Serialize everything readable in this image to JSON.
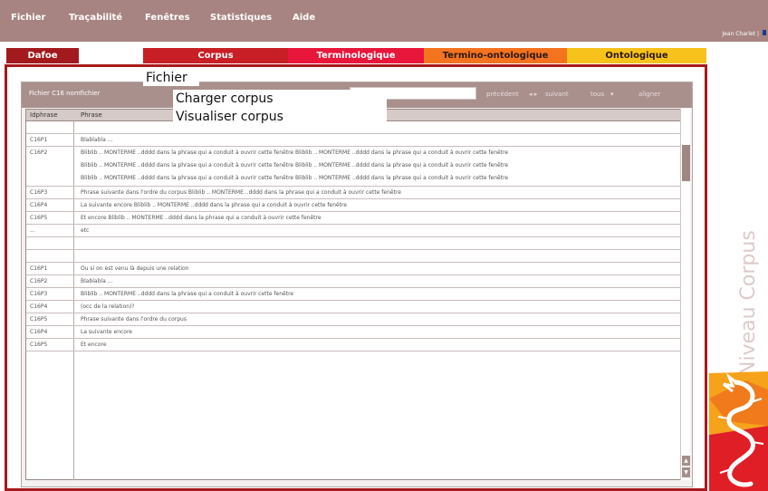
{
  "menu": [
    "Fichier",
    "Traçabilité",
    "Fenêtres",
    "Statistiques",
    "Aide"
  ],
  "user": "Jean Charlet |",
  "tabs": [
    {
      "label": "Dafoe",
      "bg": "#a21a1d",
      "color": "#ffffff"
    },
    {
      "label": "Corpus",
      "bg": "#c81e25",
      "color": "#ffffff"
    },
    {
      "label": "Terminologique",
      "bg": "#e8163a",
      "color": "#ffffff"
    },
    {
      "label": "Termino-ontologique",
      "bg": "#f4731f",
      "color": "#2a1a12"
    },
    {
      "label": "Ontologique",
      "bg": "#f7c21b",
      "color": "#2a1a12"
    }
  ],
  "panel": {
    "file_label": "Fichier C16 nomfichier",
    "precedent": "précédent",
    "suivant": "suivant",
    "tous": "tous",
    "aligner": "aligner"
  },
  "columns": [
    "Idphrase",
    "Phrase"
  ],
  "rows": [
    {
      "id": "",
      "lines": [
        ""
      ]
    },
    {
      "id": "C16P1",
      "lines": [
        "Blablabla ..."
      ]
    },
    {
      "id": "C16P2",
      "lines": [
        "Bliblib .. MONTERME ..dddd dans la phrase qui a conduit à ouvrir cette fenêtre Bliblib .. MONTERME ..dddd dans la phrase qui a conduit à ouvrir cette fenêtre",
        "Bliblib .. MONTERME ..dddd dans la phrase qui a conduit à ouvrir cette fenêtre Bliblib .. MONTERME ..dddd dans la phrase qui a conduit à ouvrir cette fenêtre",
        "Bliblib .. MONTERME ..dddd dans la phrase qui a conduit à ouvrir cette fenêtre Bliblib .. MONTERME ..dddd dans la phrase qui a conduit à ouvrir cette fenêtre"
      ]
    },
    {
      "id": "C16P3",
      "lines": [
        "Phrase suivante dans l'ordre du corpus Bliblib .. MONTERME ..dddd dans la phrase qui a conduit à ouvrir cette fenêtre"
      ]
    },
    {
      "id": "C16P4",
      "lines": [
        "La suivante encore Bliblib .. MONTERME ..dddd dans la phrase qui a conduit à ouvrir cette fenêtre"
      ]
    },
    {
      "id": "C16P5",
      "lines": [
        "Et encore Bliblib .. MONTERME ..dddd dans la phrase qui a conduit à ouvrir cette fenêtre"
      ]
    },
    {
      "id": "...",
      "lines": [
        "etc"
      ]
    },
    {
      "id": "",
      "lines": [
        ""
      ]
    },
    {
      "id": "",
      "lines": [
        ""
      ]
    },
    {
      "id": "C16P1",
      "lines": [
        "Ou si on est venu là depuis une relation"
      ]
    },
    {
      "id": "C16P2",
      "lines": [
        "Blablabla ..."
      ]
    },
    {
      "id": "C16P3",
      "lines": [
        "Bliblib .. MONTERME ..dddd dans la phrase qui a conduit à ouvrir cette fenêtre"
      ]
    },
    {
      "id": "C16P4",
      "lines": [
        "(occ de la relation)?"
      ]
    },
    {
      "id": "C16P5",
      "lines": [
        "Phrase suivante dans l'ordre du corpus"
      ]
    },
    {
      "id": "C16P4",
      "lines": [
        "La suivante encore"
      ]
    },
    {
      "id": "C16P5",
      "lines": [
        "Et encore"
      ]
    }
  ],
  "popup": {
    "title": "Fichier",
    "items": [
      "Charger corpus",
      "Visualiser corpus"
    ]
  },
  "side_label": "Niveau Corpus",
  "colors": {
    "accent": "#a8191c",
    "menubar": "#a78481",
    "panel_header": "#a9908d"
  }
}
